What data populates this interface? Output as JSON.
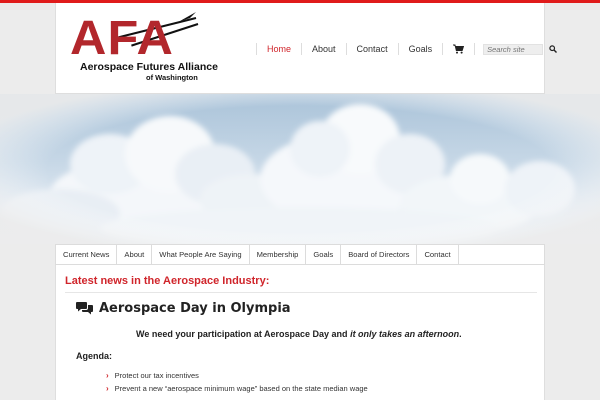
{
  "brand": {
    "logo_letters": "AFA",
    "logo_name": "Aerospace Futures Alliance",
    "logo_sub": "of Washington"
  },
  "nav": {
    "items": [
      {
        "label": "Home",
        "active": true
      },
      {
        "label": "About",
        "active": false
      },
      {
        "label": "Contact",
        "active": false
      },
      {
        "label": "Goals",
        "active": false
      }
    ],
    "cart_icon": "cart-icon",
    "search_placeholder": "Search site",
    "search_icon": "search-icon"
  },
  "tabs": [
    "Current News",
    "About",
    "What People Are Saying",
    "Membership",
    "Goals",
    "Board of Directors",
    "Contact"
  ],
  "content": {
    "heading": "Latest news in the Aerospace Industry:",
    "post_title": "Aerospace Day in Olympia",
    "intro_part1": "We need your participation at  Aerospace Day and ",
    "intro_emphasis": "it only takes an afternoon",
    "intro_part2": ".",
    "agenda_label": "Agenda:",
    "agenda_items": [
      "Protect our tax incentives",
      "Prevent a new “aerospace minimum wage” based on the state median wage"
    ]
  },
  "colors": {
    "accent": "#d0252b",
    "logo_red": "#b2272c",
    "top_stripe": "#e01b1b"
  }
}
